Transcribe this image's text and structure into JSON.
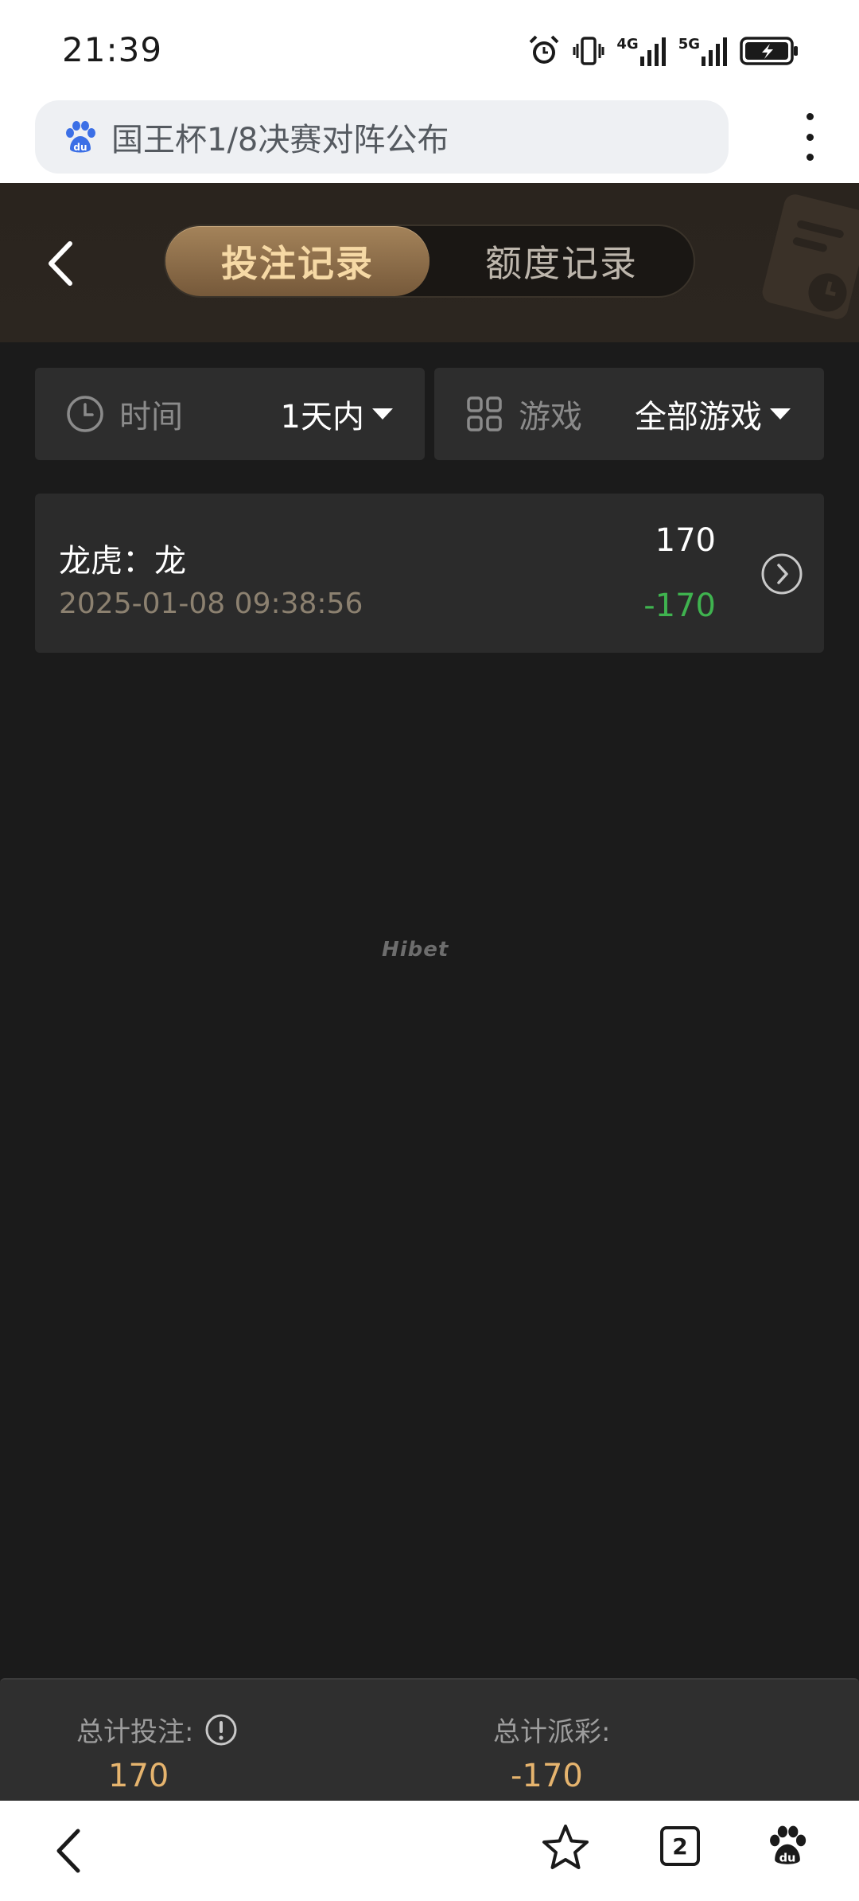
{
  "status_bar": {
    "time": "21:39",
    "net1": "4G",
    "net2": "5G"
  },
  "browser": {
    "url_title": "国王杯1/8决赛对阵公布",
    "tab_count": "2"
  },
  "header": {
    "tabs": [
      {
        "label": "投注记录",
        "active": true
      },
      {
        "label": "额度记录",
        "active": false
      }
    ]
  },
  "filters": {
    "time": {
      "label": "时间",
      "value": "1天内"
    },
    "game": {
      "label": "游戏",
      "value": "全部游戏"
    }
  },
  "records": [
    {
      "title": "龙虎：龙",
      "time": "2025-01-08 09:38:56",
      "amount": "170",
      "result": "-170"
    }
  ],
  "watermark": "Hibet",
  "summary": {
    "total_bet_label": "总计投注:",
    "total_bet_value": "170",
    "total_payout_label": "总计派彩:",
    "total_payout_value": "-170"
  },
  "colors": {
    "page_bg": "#1b1b1b",
    "card_bg": "#2b2b2b",
    "active_tab_text": "#f6d9a5",
    "gold_value": "#e6b46e",
    "result_green": "#3fb34f"
  }
}
